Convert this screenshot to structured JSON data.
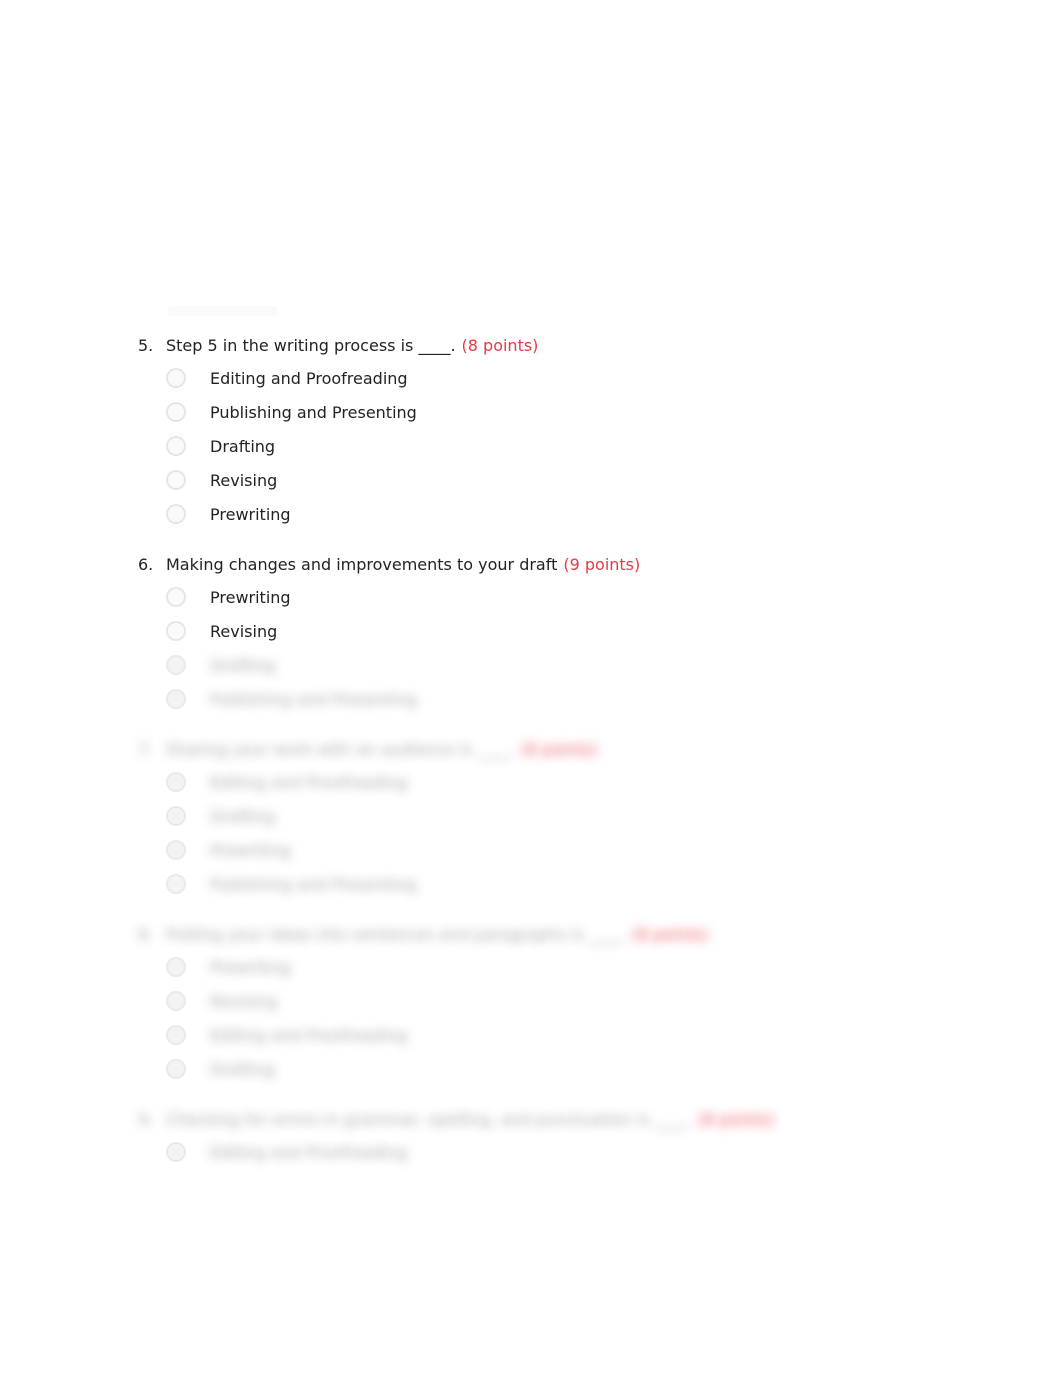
{
  "questions": [
    {
      "number": "5.",
      "text": "Step 5 in the writing process is ____.",
      "points": "(8 points)",
      "blurred": false,
      "options": [
        {
          "label": "Editing and Proofreading"
        },
        {
          "label": "Publishing and Presenting"
        },
        {
          "label": "Drafting"
        },
        {
          "label": "Revising"
        },
        {
          "label": "Prewriting"
        }
      ]
    },
    {
      "number": "6.",
      "text": "Making changes and improvements to your draft",
      "points": "(9 points)",
      "blurred": false,
      "options": [
        {
          "label": "Prewriting",
          "clear": true
        },
        {
          "label": "Revising",
          "clear": true
        },
        {
          "label": "Drafting",
          "clear": false
        },
        {
          "label": "Publishing and Presenting",
          "clear": false
        }
      ],
      "trailing_blur": true
    },
    {
      "number": "7.",
      "text": "Sharing your work with an audience is ____.",
      "points": "(8 points)",
      "blurred": true,
      "options": [
        {
          "label": "Editing and Proofreading"
        },
        {
          "label": "Drafting"
        },
        {
          "label": "Prewriting"
        },
        {
          "label": "Publishing and Presenting"
        }
      ]
    },
    {
      "number": "8.",
      "text": "Putting your ideas into sentences and paragraphs is ____.",
      "points": "(8 points)",
      "blurred": true,
      "options": [
        {
          "label": "Prewriting"
        },
        {
          "label": "Revising"
        },
        {
          "label": "Editing and Proofreading"
        },
        {
          "label": "Drafting"
        }
      ]
    },
    {
      "number": "9.",
      "text": "Checking for errors in grammar, spelling, and punctuation is ____.",
      "points": "(8 points)",
      "blurred": true,
      "options": [
        {
          "label": "Editing and Proofreading"
        }
      ]
    }
  ]
}
